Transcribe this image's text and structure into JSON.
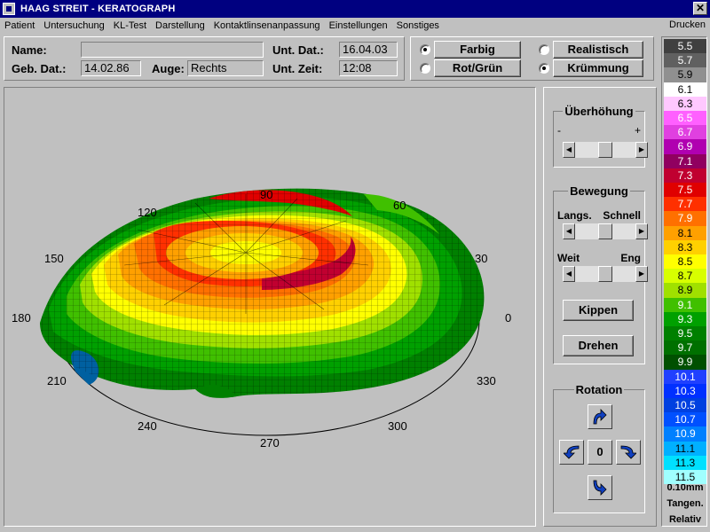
{
  "window": {
    "title": "HAAG STREIT  -  KERATOGRAPH"
  },
  "menu": {
    "items": [
      "Patient",
      "Untersuchung",
      "KL-Test",
      "Darstellung",
      "Kontaktlinsenanpassung",
      "Einstellungen",
      "Sonstiges"
    ],
    "print": "Drucken"
  },
  "patient": {
    "name_label": "Name:",
    "name_value": "",
    "dob_label": "Geb. Dat.:",
    "dob_value": "14.02.86",
    "eye_label": "Auge:",
    "eye_value": "Rechts",
    "exam_date_label": "Unt. Dat.:",
    "exam_date_value": "16.04.03",
    "exam_time_label": "Unt. Zeit:",
    "exam_time_value": "12:08"
  },
  "modes": {
    "farbig": "Farbig",
    "rotgruen": "Rot/Grün",
    "realistisch": "Realistisch",
    "kruemmung": "Krümmung",
    "selected_color": "Farbig",
    "selected_view": "Krümmung"
  },
  "controls": {
    "ueberhoehung": "Überhöhung",
    "minus": "-",
    "plus": "+",
    "bewegung": "Bewegung",
    "langs": "Langs.",
    "schnell": "Schnell",
    "weit": "Weit",
    "eng": "Eng",
    "kippen": "Kippen",
    "drehen": "Drehen",
    "rotation": "Rotation",
    "rotation_value": "0",
    "ueberhoehung_level": 0.5,
    "speed_level": 0.5,
    "distance_level": 0.5
  },
  "plot": {
    "angle_labels": [
      "0",
      "30",
      "60",
      "90",
      "120",
      "150",
      "180",
      "210",
      "240",
      "270",
      "300",
      "330"
    ]
  },
  "scale": {
    "values": [
      "5.5",
      "5.7",
      "5.9",
      "6.1",
      "6.3",
      "6.5",
      "6.7",
      "6.9",
      "7.1",
      "7.3",
      "7.5",
      "7.7",
      "7.9",
      "8.1",
      "8.3",
      "8.5",
      "8.7",
      "8.9",
      "9.1",
      "9.3",
      "9.5",
      "9.7",
      "9.9",
      "10.1",
      "10.3",
      "10.5",
      "10.7",
      "10.9",
      "11.1",
      "11.3",
      "11.5"
    ],
    "colors": [
      "#404040",
      "#606060",
      "#909090",
      "#ffffff",
      "#ffc8ff",
      "#ff60ff",
      "#e040e0",
      "#b000b0",
      "#900060",
      "#c00030",
      "#e00000",
      "#ff3000",
      "#ff7000",
      "#ffa000",
      "#ffd000",
      "#ffff00",
      "#d8ff00",
      "#a0e000",
      "#40c000",
      "#00a000",
      "#008000",
      "#007000",
      "#005000",
      "#2040ff",
      "#0030ff",
      "#0040e0",
      "#0050ff",
      "#0080ff",
      "#00b0ff",
      "#00e0ff",
      "#a0ffff"
    ],
    "unit": "0.10mm",
    "mode": "Tangen.",
    "relativ": "Relativ"
  }
}
